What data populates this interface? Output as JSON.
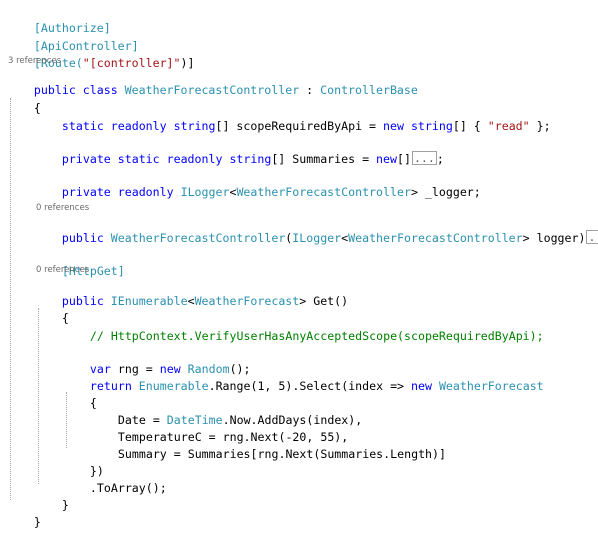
{
  "code": {
    "l1": "[Authorize]",
    "l2": "[ApiController]",
    "l3_a": "[Route(",
    "l3_b": "\"[controller]\"",
    "l3_c": ")]",
    "lens_class": "3 references",
    "l4_kw": "public class",
    "l4_type": "WeatherForecastController",
    "l4_sep": " : ",
    "l4_base": "ControllerBase",
    "brace_open": "{",
    "brace_close": "}",
    "l5_kw": "static readonly string",
    "l5_a": "[] scopeRequiredByApi = ",
    "l5_new": "new",
    "l5_str_kw": " string",
    "l5_b": "[] { ",
    "l5_val": "\"read\"",
    "l5_c": " };",
    "l6_kw": "private static readonly string",
    "l6_a": "[] Summaries = ",
    "l6_new": "new",
    "l6_b": "[]",
    "fold_text": "...",
    "l6_end": ";",
    "l7_kw": "private readonly",
    "l7_iface": " ILogger",
    "l7_a": "<",
    "l7_type": "WeatherForecastController",
    "l7_b": "> _logger;",
    "lens_ctor": "0 references",
    "l8_kw": "public",
    "l8_type": " WeatherForecastController",
    "l8_a": "(",
    "l8_iface": "ILogger",
    "l8_b": "<",
    "l8_type2": "WeatherForecastController",
    "l8_c": "> logger)",
    "l9": "[HttpGet]",
    "lens_get": "0 references",
    "l10_kw": "public",
    "l10_iface": " IEnumerable",
    "l10_a": "<",
    "l10_type": "WeatherForecast",
    "l10_b": "> Get()",
    "l11_cmt": "// HttpContext.VerifyUserHasAnyAcceptedScope(scopeRequiredByApi);",
    "l12_kw": "var",
    "l12_a": " rng = ",
    "l12_new": "new",
    "l12_type": " Random",
    "l12_b": "();",
    "l13_kw": "return",
    "l13_type": " Enumerable",
    "l13_a": ".Range(1, 5).Select(index => ",
    "l13_new": "new",
    "l13_type2": " WeatherForecast",
    "l14_a": "Date = ",
    "l14_type": "DateTime",
    "l14_b": ".Now.AddDays(index),",
    "l15": "TemperatureC = rng.Next(-20, 55),",
    "l16": "Summary = Summaries[rng.Next(Summaries.Length)]",
    "l17": "})",
    "l18": ".ToArray();"
  }
}
